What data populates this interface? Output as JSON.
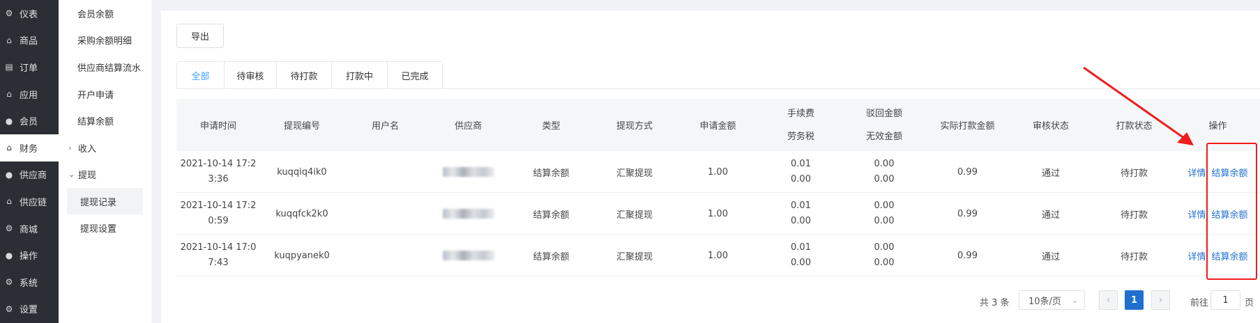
{
  "nav_primary": [
    {
      "label": "仪表",
      "icon": "gear-icon"
    },
    {
      "label": "商品",
      "icon": "home-icon"
    },
    {
      "label": "订单",
      "icon": "document-icon"
    },
    {
      "label": "应用",
      "icon": "home-icon"
    },
    {
      "label": "会员",
      "icon": "user-icon"
    },
    {
      "label": "财务",
      "icon": "home-icon",
      "active": true
    },
    {
      "label": "供应商",
      "icon": "user-icon"
    },
    {
      "label": "供应链",
      "icon": "home-icon"
    },
    {
      "label": "商城",
      "icon": "gear-icon"
    },
    {
      "label": "操作",
      "icon": "user-icon"
    },
    {
      "label": "系统",
      "icon": "gear-icon"
    },
    {
      "label": "设置",
      "icon": "gear-icon"
    }
  ],
  "nav_secondary": {
    "items": [
      "会员余额",
      "采购余额明细",
      "供应商结算流水",
      "开户申请",
      "结算余额"
    ],
    "group_income": "收入",
    "group_withdraw": "提现",
    "sub_items": [
      "提现记录",
      "提现设置"
    ]
  },
  "toolbar": {
    "export_label": "导出"
  },
  "tabs": [
    "全部",
    "待审核",
    "待打款",
    "打款中",
    "已完成"
  ],
  "table": {
    "headers": {
      "apply_time": "申请时间",
      "withdraw_no": "提现编号",
      "username": "用户名",
      "supplier": "供应商",
      "type": "类型",
      "method": "提现方式",
      "amount": "申请金额",
      "fee": "手续费",
      "labor_tax": "劳务税",
      "reject_amount": "驳回金额",
      "invalid_amount": "无效金额",
      "actual_amount": "实际打款金额",
      "audit_status": "审核状态",
      "pay_status": "打款状态",
      "operation": "操作"
    },
    "rows": [
      {
        "time_1": "2021-10-14 17:2",
        "time_2": "3:36",
        "no": "kuqqiq4ik0",
        "username": "",
        "type": "结算余额",
        "method": "汇聚提现",
        "amount": "1.00",
        "fee": "0.01",
        "labor_tax": "0.00",
        "reject": "0.00",
        "invalid": "0.00",
        "actual": "0.99",
        "audit": "通过",
        "pay": "待打款",
        "op_detail": "详情",
        "op_settle": "结算余额"
      },
      {
        "time_1": "2021-10-14 17:2",
        "time_2": "0:59",
        "no": "kuqqfck2k0",
        "username": "",
        "type": "结算余额",
        "method": "汇聚提现",
        "amount": "1.00",
        "fee": "0.01",
        "labor_tax": "0.00",
        "reject": "0.00",
        "invalid": "0.00",
        "actual": "0.99",
        "audit": "通过",
        "pay": "待打款",
        "op_detail": "详情",
        "op_settle": "结算余额"
      },
      {
        "time_1": "2021-10-14 17:0",
        "time_2": "7:43",
        "no": "kuqpyanek0",
        "username": "",
        "type": "结算余额",
        "method": "汇聚提现",
        "amount": "1.00",
        "fee": "0.01",
        "labor_tax": "0.00",
        "reject": "0.00",
        "invalid": "0.00",
        "actual": "0.99",
        "audit": "通过",
        "pay": "待打款",
        "op_detail": "详情",
        "op_settle": "结算余额"
      }
    ]
  },
  "pagination": {
    "total": "共 3 条",
    "page_size": "10条/页",
    "current_page": "1",
    "goto_prefix": "前往",
    "goto_value": "1",
    "goto_suffix": "页"
  },
  "colors": {
    "accent": "#1f6fd1",
    "annotation": "#ee1c1c",
    "sidebar_bg": "#2b2e35"
  }
}
